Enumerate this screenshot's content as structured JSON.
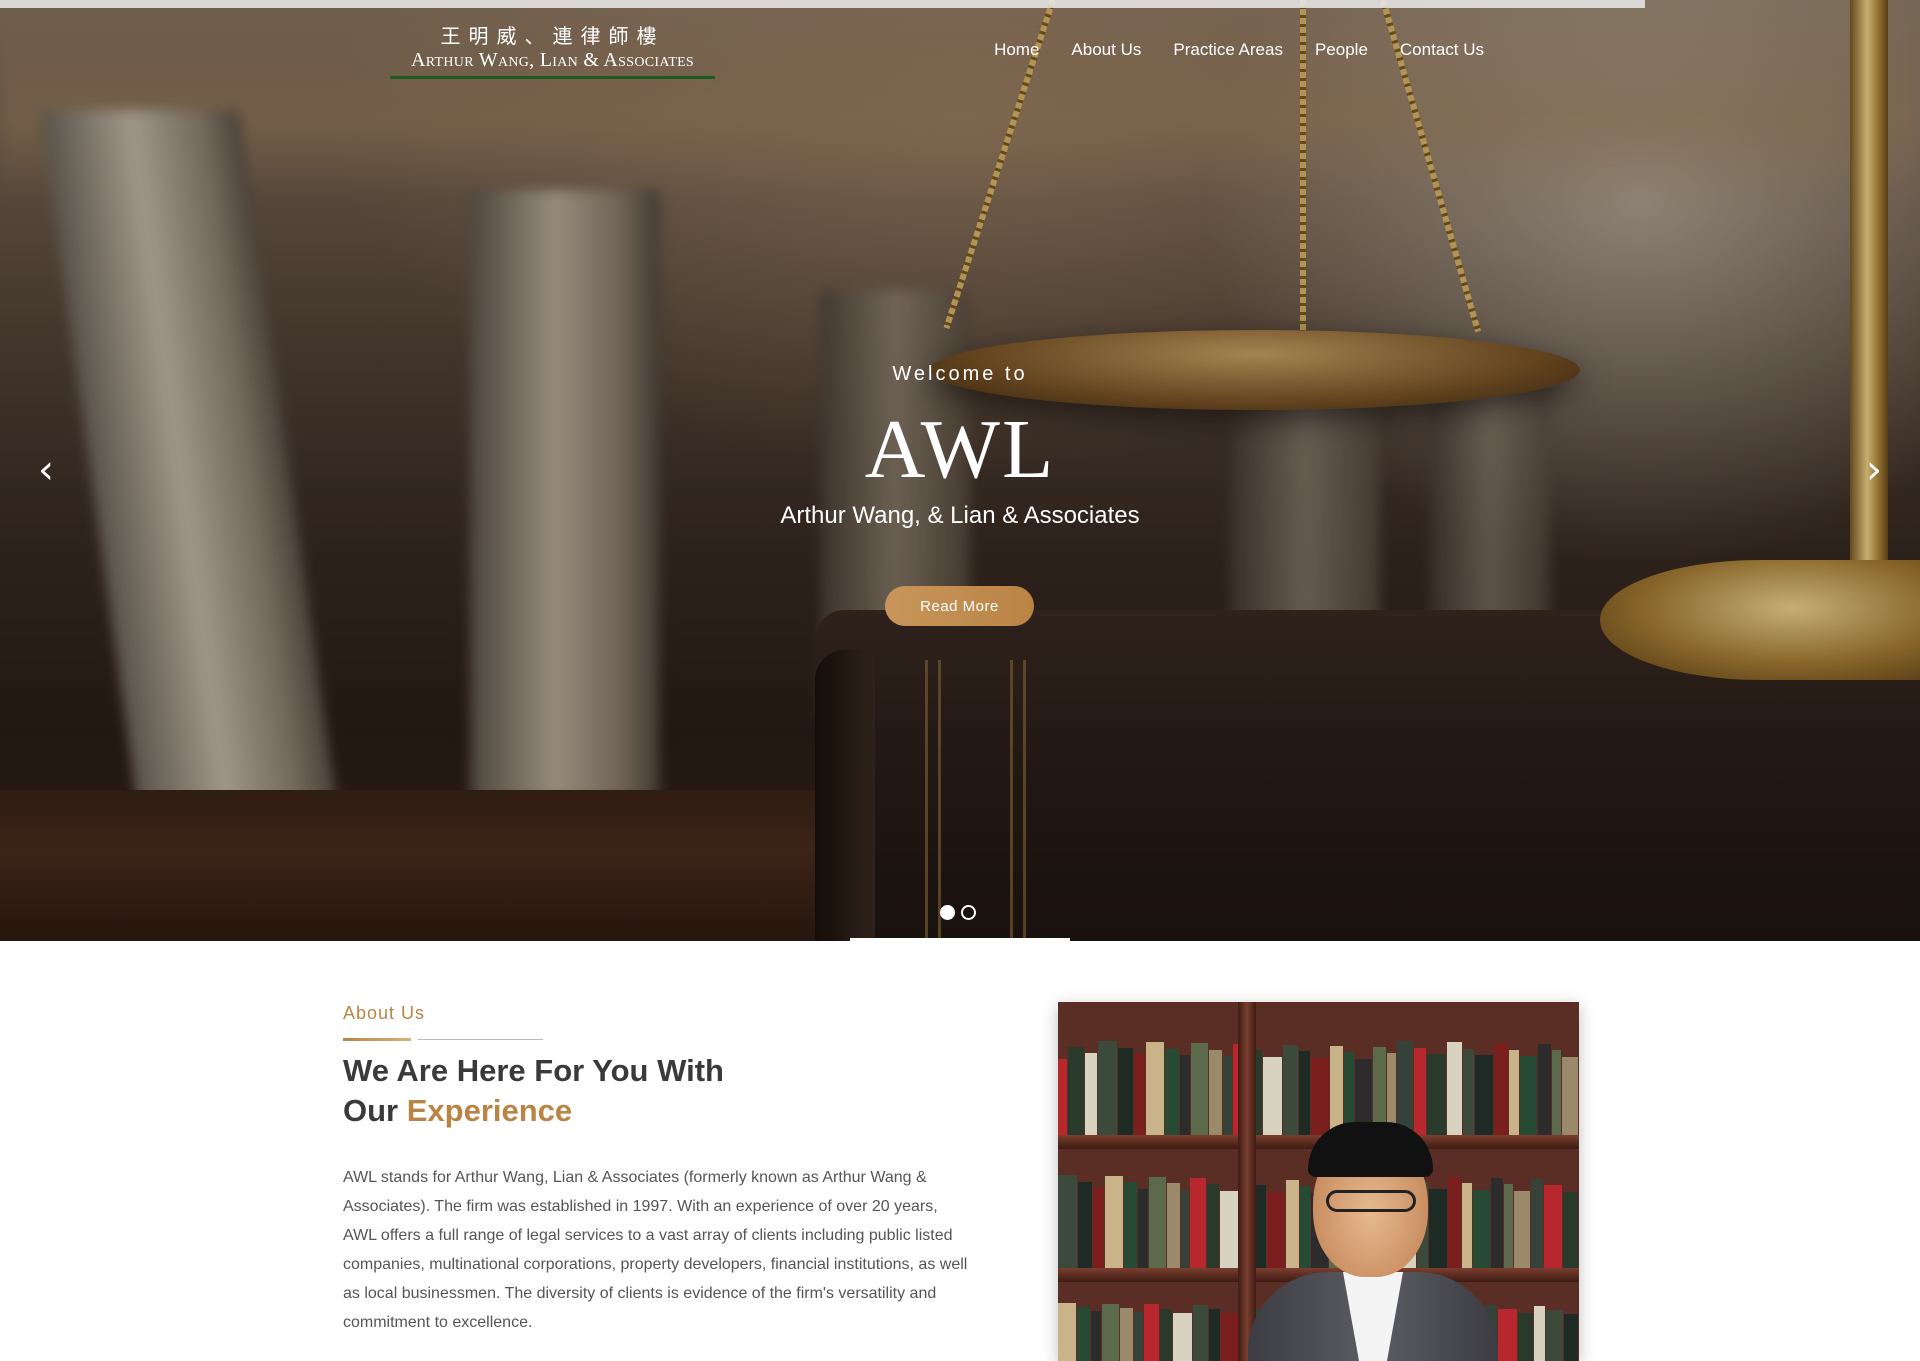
{
  "logo": {
    "chinese": "王明威、連律師樓",
    "english": "Arthur Wang, Lian & Associates"
  },
  "nav": {
    "items": [
      {
        "label": "Home"
      },
      {
        "label": "About Us"
      },
      {
        "label": "Practice Areas"
      },
      {
        "label": "People"
      },
      {
        "label": "Contact Us"
      }
    ]
  },
  "hero": {
    "welcome": "Welcome to",
    "title": "AWL",
    "subtitle": "Arthur Wang, & Lian & Associates",
    "cta_label": "Read More",
    "prev_icon": "‹",
    "next_icon": "›",
    "slides_total": 2,
    "active_slide": 1
  },
  "about": {
    "label": "About Us",
    "heading_line1": "We Are Here For You With",
    "heading_line2_prefix": "Our ",
    "heading_line2_accent": "Experience",
    "body": "AWL stands for Arthur Wang, Lian & Associates (formerly known as Arthur Wang & Associates). The firm was established in 1997. With an experience of over 20 years, AWL offers a full range of legal services to a vast array of clients including public listed companies, multinational corporations, property developers, financial institutions, as well as local businessmen. The diversity of clients is evidence of the firm's versatility and commitment to excellence."
  },
  "colors": {
    "accent_gold": "#b98444",
    "heading_dark": "#3a3a3a",
    "logo_underline": "#1e5a1e"
  }
}
